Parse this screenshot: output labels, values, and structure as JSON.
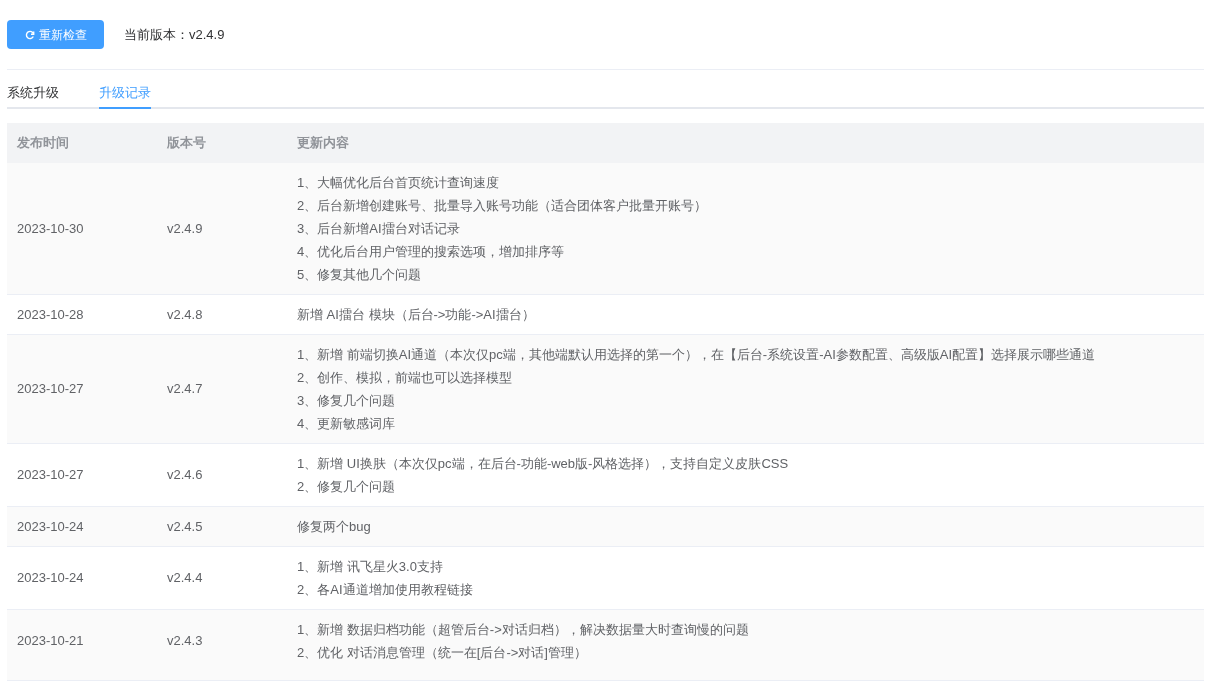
{
  "toolbar": {
    "check_button": "重新检查",
    "current_version": "当前版本：v2.4.9"
  },
  "tabs": [
    {
      "label": "系统升级",
      "selected": false
    },
    {
      "label": "升级记录",
      "selected": true
    }
  ],
  "table": {
    "columns": [
      "发布时间",
      "版本号",
      "更新内容"
    ],
    "rows": [
      {
        "date": "2023-10-30",
        "version": "v2.4.9",
        "content": [
          "1、大幅优化后台首页统计查询速度",
          "2、后台新增创建账号、批量导入账号功能（适合团体客户批量开账号）",
          "3、后台新增AI擂台对话记录",
          "4、优化后台用户管理的搜索选项，增加排序等",
          "5、修复其他几个问题"
        ]
      },
      {
        "date": "2023-10-28",
        "version": "v2.4.8",
        "content": [
          "新增 AI擂台 模块（后台->功能->AI擂台）"
        ]
      },
      {
        "date": "2023-10-27",
        "version": "v2.4.7",
        "content": [
          "1、新增 前端切换AI通道（本次仅pc端，其他端默认用选择的第一个），在【后台-系统设置-AI参数配置、高级版AI配置】选择展示哪些通道",
          "2、创作、模拟，前端也可以选择模型",
          "3、修复几个问题",
          "4、更新敏感词库"
        ]
      },
      {
        "date": "2023-10-27",
        "version": "v2.4.6",
        "content": [
          "1、新增 UI换肤（本次仅pc端，在后台-功能-web版-风格选择），支持自定义皮肤CSS",
          "2、修复几个问题"
        ]
      },
      {
        "date": "2023-10-24",
        "version": "v2.4.5",
        "content": [
          "修复两个bug"
        ]
      },
      {
        "date": "2023-10-24",
        "version": "v2.4.4",
        "content": [
          "1、新增 讯飞星火3.0支持",
          "2、各AI通道增加使用教程链接"
        ]
      },
      {
        "date": "2023-10-21",
        "version": "v2.4.3",
        "content": [
          "1、新增 数据归档功能（超管后台->对话归档），解决数据量大时查询慢的问题",
          "2、优化 对话消息管理（统一在[后台->对话]管理）"
        ]
      }
    ]
  }
}
